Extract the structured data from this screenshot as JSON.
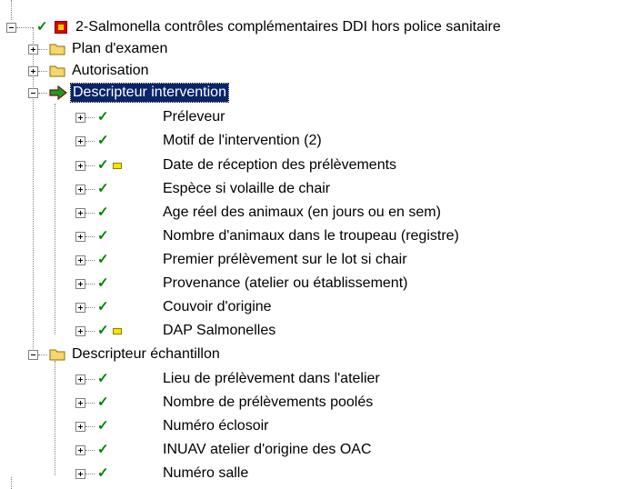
{
  "root": {
    "label": "2-Salmonella contrôles complémentaires DDI hors police sanitaire"
  },
  "level1": [
    {
      "label": "Plan d'examen"
    },
    {
      "label": "Autorisation"
    },
    {
      "label": "Descripteur intervention"
    },
    {
      "label": "Descripteur échantillon"
    }
  ],
  "intervention_items": [
    {
      "label": "Préleveur"
    },
    {
      "label": "Motif de l'intervention (2)"
    },
    {
      "label": "Date de réception des prélèvements"
    },
    {
      "label": "Espèce si volaille de chair"
    },
    {
      "label": "Age réel des animaux (en jours ou en sem)"
    },
    {
      "label": "Nombre d'animaux dans le troupeau (registre)"
    },
    {
      "label": "Premier prélèvement sur le lot si chair"
    },
    {
      "label": "Provenance (atelier ou établissement)"
    },
    {
      "label": "Couvoir d'origine"
    },
    {
      "label": "DAP Salmonelles"
    }
  ],
  "echantillon_items": [
    {
      "label": "Lieu de prélèvement dans l'atelier"
    },
    {
      "label": "Nombre de prélèvements poolés"
    },
    {
      "label": "Numéro  éclosoir"
    },
    {
      "label": "INUAV atelier d'origine des OAC"
    },
    {
      "label": "Numéro salle"
    }
  ],
  "icons": {
    "check": "checkmark-icon",
    "folder": "folder-icon",
    "arrow": "green-arrow-icon",
    "flag": "yellow-flag-icon",
    "root": "red-document-icon"
  },
  "colors": {
    "check": "#008000",
    "selection": "#0a246a",
    "folder": "#f5d76e"
  }
}
